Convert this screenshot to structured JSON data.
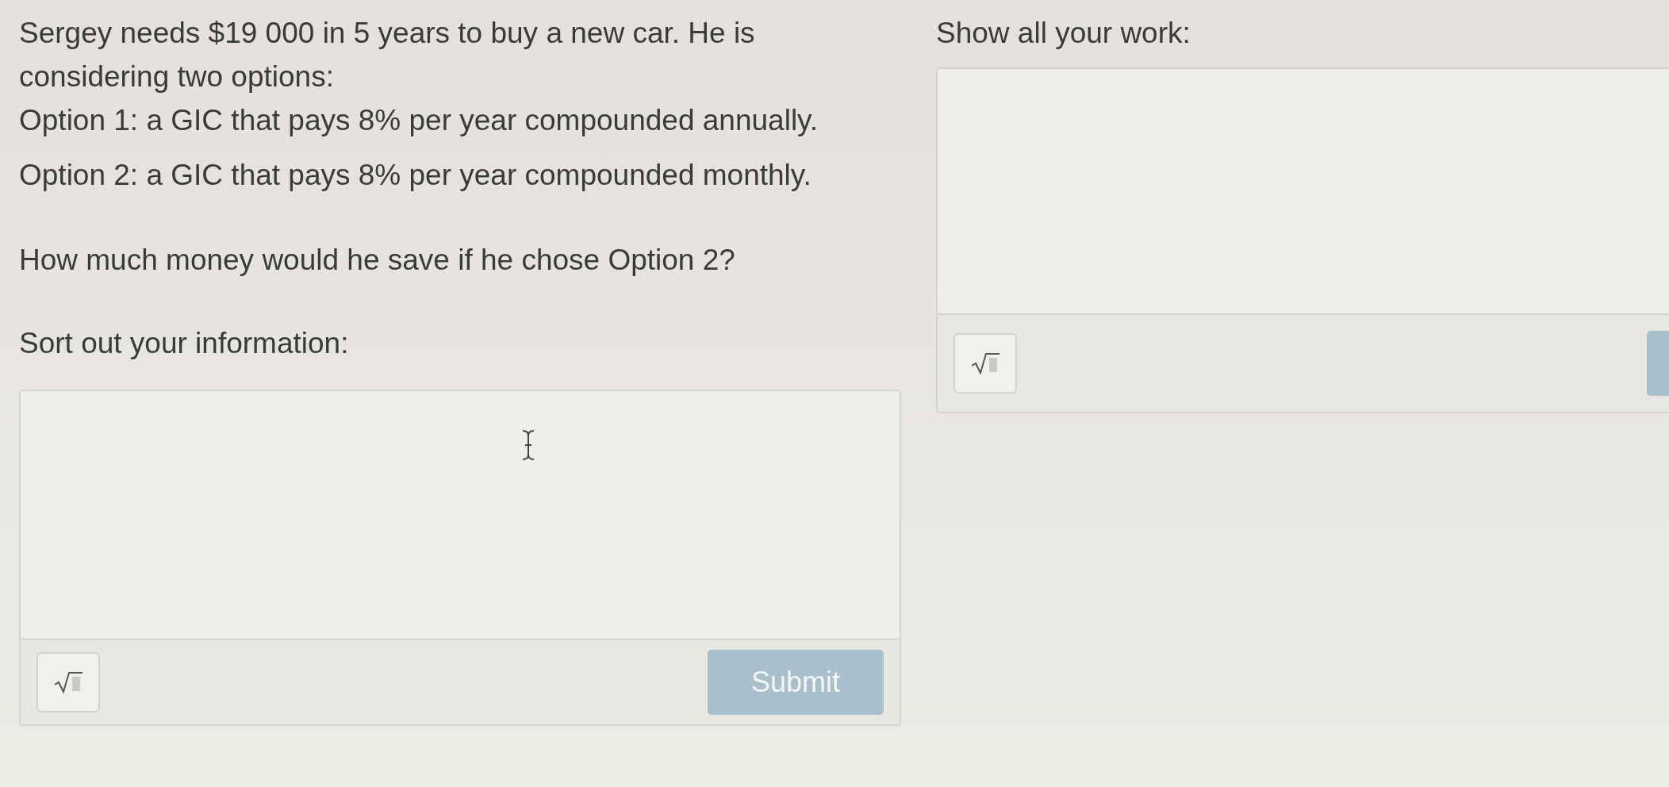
{
  "problem": {
    "intro": "Sergey needs $19 000 in 5 years to buy a new car. He is considering two options:",
    "options": [
      "Option 1: a GIC that pays 8% per year compounded annually.",
      "Option 2: a GIC that pays 8% per year compounded monthly."
    ],
    "question": "How much money would he save if he chose Option 2?"
  },
  "info_section": {
    "label": "Sort out your information:",
    "submit": "Submit"
  },
  "work_section": {
    "label": "Show all your work:"
  }
}
